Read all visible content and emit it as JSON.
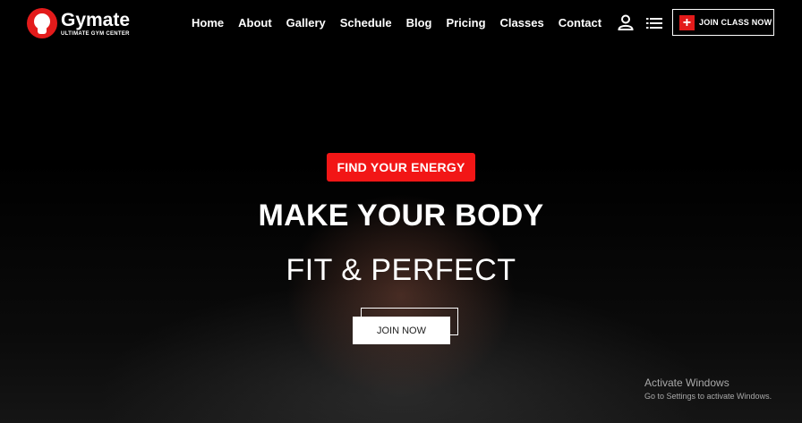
{
  "header": {
    "logo_name": "Gymate",
    "logo_tagline": "ULTIMATE GYM CENTER",
    "nav": [
      "Home",
      "About",
      "Gallery",
      "Schedule",
      "Blog",
      "Pricing",
      "Classes",
      "Contact"
    ],
    "join_class_label": "JOIN CLASS NOW",
    "icons": {
      "user": "user-icon",
      "menu": "list-menu-icon",
      "plus": "plus-icon"
    }
  },
  "hero": {
    "badge": "FIND YOUR ENERGY",
    "title_line1": "MAKE YOUR BODY",
    "title_line2": "FIT & PERFECT",
    "cta_label": "JOIN NOW"
  },
  "windows_watermark": {
    "line1": "Activate Windows",
    "line2": "Go to Settings to activate Windows."
  },
  "colors": {
    "accent": "#f21616",
    "background": "#000000",
    "text": "#ffffff"
  }
}
